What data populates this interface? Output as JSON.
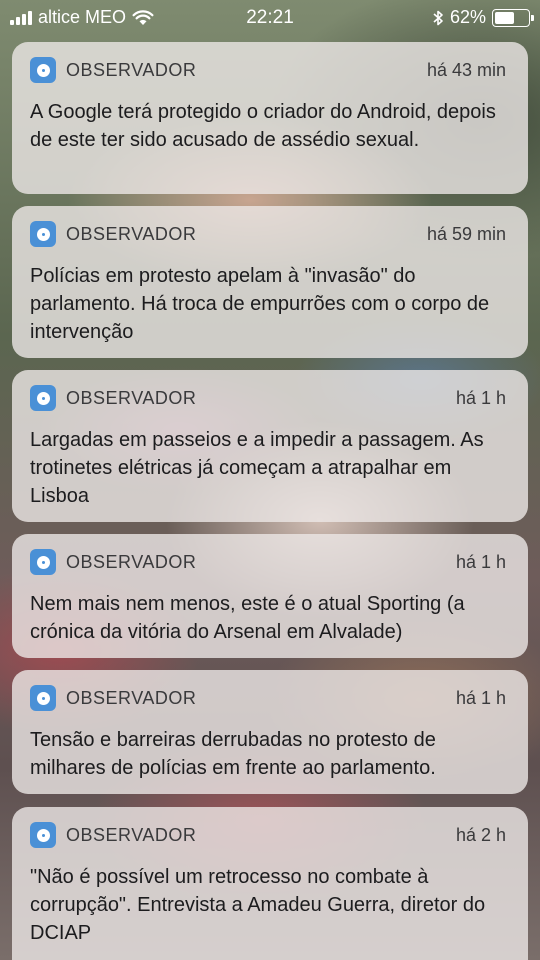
{
  "status_bar": {
    "carrier": "altice MEO",
    "time": "22:21",
    "battery_percent": "62%",
    "battery_level": 0.62
  },
  "notifications": [
    {
      "app": "OBSERVADOR",
      "time": "há 43 min",
      "text": "A Google terá protegido o criador do Android, depois de este ter sido acusado de assédio sexual."
    },
    {
      "app": "OBSERVADOR",
      "time": "há 59 min",
      "text": "Polícias em protesto apelam à \"invasão\" do parlamento. Há troca de empurrões com o corpo de intervenção"
    },
    {
      "app": "OBSERVADOR",
      "time": "há 1 h",
      "text": "Largadas em passeios e a impedir a passagem. As trotinetes elétricas já começam a atrapalhar em Lisboa"
    },
    {
      "app": "OBSERVADOR",
      "time": "há 1 h",
      "text": "Nem mais nem menos, este é o atual Sporting (a crónica da vitória do Arsenal em Alvalade)"
    },
    {
      "app": "OBSERVADOR",
      "time": "há 1 h",
      "text": "Tensão e barreiras derrubadas no protesto de milhares de polícias em frente ao parlamento."
    },
    {
      "app": "OBSERVADOR",
      "time": "há 2 h",
      "text": "\"Não é possível um retrocesso no combate à corrupção\". Entrevista a Amadeu Guerra, diretor do DCIAP"
    }
  ]
}
